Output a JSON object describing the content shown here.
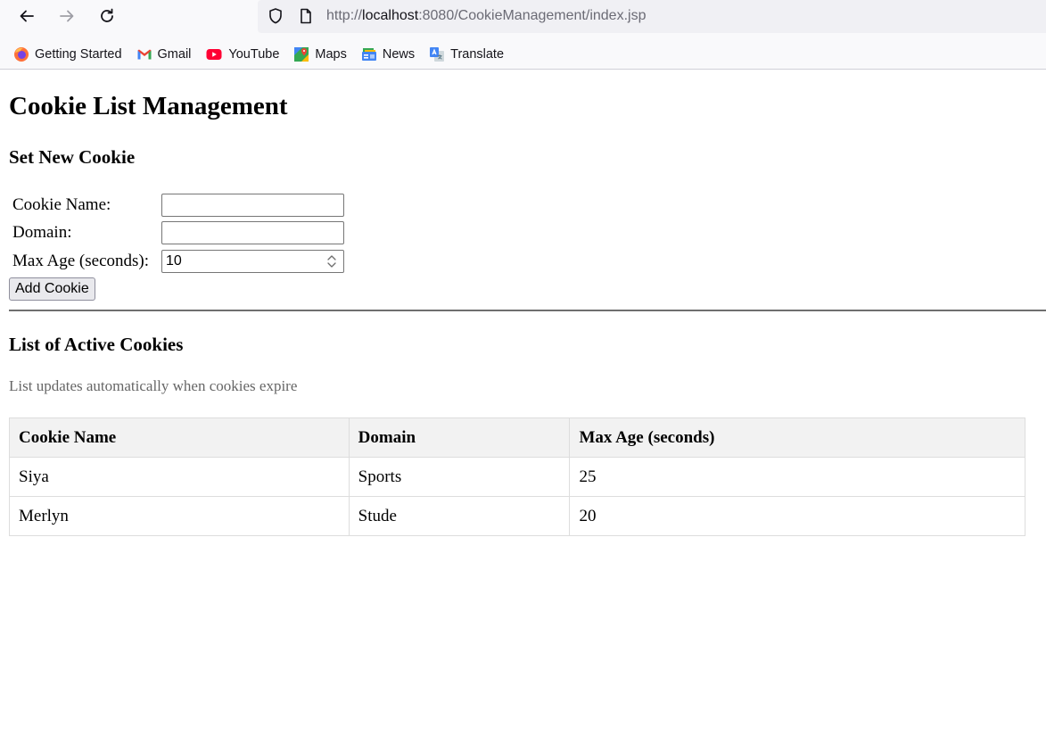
{
  "browser": {
    "url_prefix": "http://",
    "url_host": "localhost",
    "url_rest": ":8080/CookieManagement/index.jsp",
    "bookmarks": [
      {
        "label": "Getting Started",
        "icon": "firefox-icon"
      },
      {
        "label": "Gmail",
        "icon": "gmail-icon"
      },
      {
        "label": "YouTube",
        "icon": "youtube-icon"
      },
      {
        "label": "Maps",
        "icon": "maps-icon"
      },
      {
        "label": "News",
        "icon": "news-icon"
      },
      {
        "label": "Translate",
        "icon": "translate-icon"
      }
    ]
  },
  "page": {
    "title": "Cookie List Management",
    "form": {
      "heading": "Set New Cookie",
      "name_label": "Cookie Name:",
      "name_value": "",
      "domain_label": "Domain:",
      "domain_value": "",
      "maxage_label": "Max Age (seconds):",
      "maxage_value": "10",
      "submit_label": "Add Cookie"
    },
    "list": {
      "heading": "List of Active Cookies",
      "note": "List updates automatically when cookies expire",
      "columns": [
        "Cookie Name",
        "Domain",
        "Max Age (seconds)"
      ],
      "rows": [
        [
          "Siya",
          "Sports",
          "25"
        ],
        [
          "Merlyn",
          "Stude",
          "20"
        ]
      ]
    }
  }
}
